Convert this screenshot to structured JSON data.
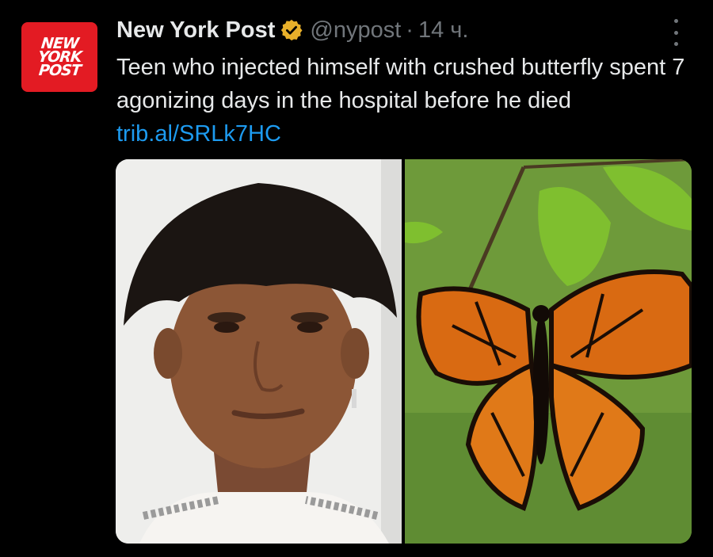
{
  "author": {
    "logo_lines": [
      "NEW",
      "YORK",
      "POST"
    ],
    "name": "New York Post",
    "handle": "@nypost",
    "separator": "·",
    "time": "14 ч.",
    "verified_icon": "verified-badge-gold"
  },
  "tweet": {
    "text": "Teen who injected himself with crushed butterfly spent 7 agonizing days in the hospital before he died",
    "link": "trib.al/SRLk7HC"
  },
  "media": {
    "items": [
      {
        "subject": "teen-portrait-photo"
      },
      {
        "subject": "monarch-butterfly-photo"
      }
    ]
  },
  "menu": {
    "icon": "more-vertical-icon"
  },
  "colors": {
    "background": "#000000",
    "text": "#e7e9ea",
    "muted": "#71767b",
    "link": "#1d9bf0",
    "brand_red": "#e31b23",
    "verified_gold": "#e8b02a"
  }
}
